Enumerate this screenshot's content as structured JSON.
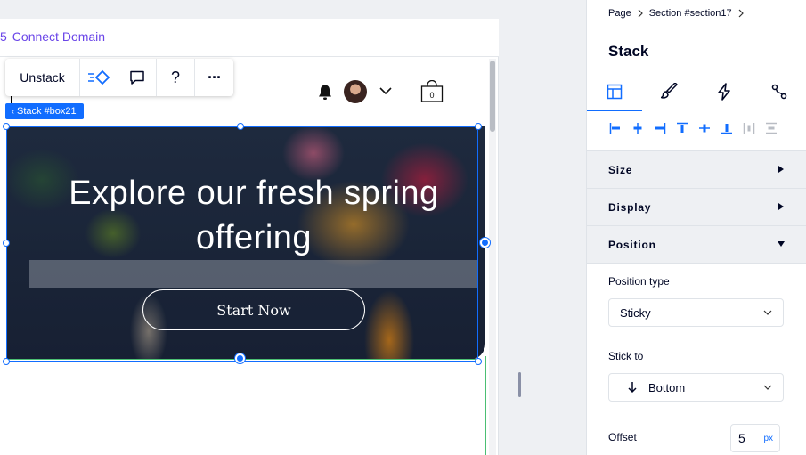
{
  "editor": {
    "connect_domain_prefix": "5",
    "connect_domain": "Connect Domain",
    "toolbar": {
      "unstack_label": "Unstack",
      "help_label": "?",
      "more_label": "···"
    },
    "selection_label": "Stack #box21"
  },
  "site": {
    "hero": {
      "title": "Explore our fresh spring offering",
      "button_label": "Start Now"
    },
    "cart_count": "0"
  },
  "panel": {
    "breadcrumbs": [
      "Page",
      "Section #section17"
    ],
    "title": "Stack",
    "sections": {
      "size": "Size",
      "display": "Display",
      "position": "Position"
    },
    "position_type_label": "Position type",
    "position_type_value": "Sticky",
    "stick_to_label": "Stick to",
    "stick_to_value": "Bottom",
    "offset_label": "Offset",
    "offset_value": "5",
    "offset_unit": "px"
  },
  "colors": {
    "accent": "#116dff",
    "connect_domain": "#6a45e8",
    "guide_green": "#4bbf73"
  }
}
